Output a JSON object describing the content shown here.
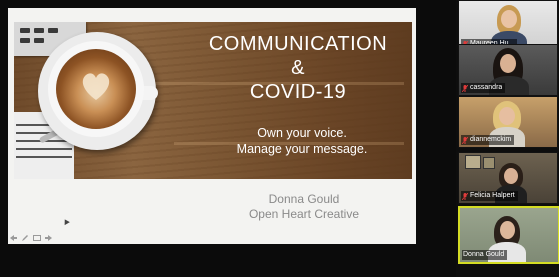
{
  "slide": {
    "title_line1": "COMMUNICATION",
    "title_line2": "&",
    "title_line3": "COVID-19",
    "tagline_line1": "Own your voice.",
    "tagline_line2": "Manage your message.",
    "presenter_name": "Donna Gould",
    "presenter_company": "Open Heart Creative"
  },
  "slide_toolbar": {
    "icons": [
      "arrow-icon",
      "pen-icon",
      "slides-icon",
      "next-icon"
    ]
  },
  "participants": [
    {
      "name": "Maureen Hu...",
      "muted": true,
      "active": false
    },
    {
      "name": "cassandra",
      "muted": true,
      "active": false
    },
    {
      "name": "diannemckim",
      "muted": true,
      "active": false
    },
    {
      "name": "Felicia Halpert",
      "muted": true,
      "active": false
    },
    {
      "name": "Donna Gould",
      "muted": false,
      "active": true
    }
  ],
  "colors": {
    "active_speaker_border": "#d4dc24",
    "muted_icon": "#e03b3b",
    "slide_background": "#f3f3f1",
    "presenter_text": "#8a8a8a"
  }
}
